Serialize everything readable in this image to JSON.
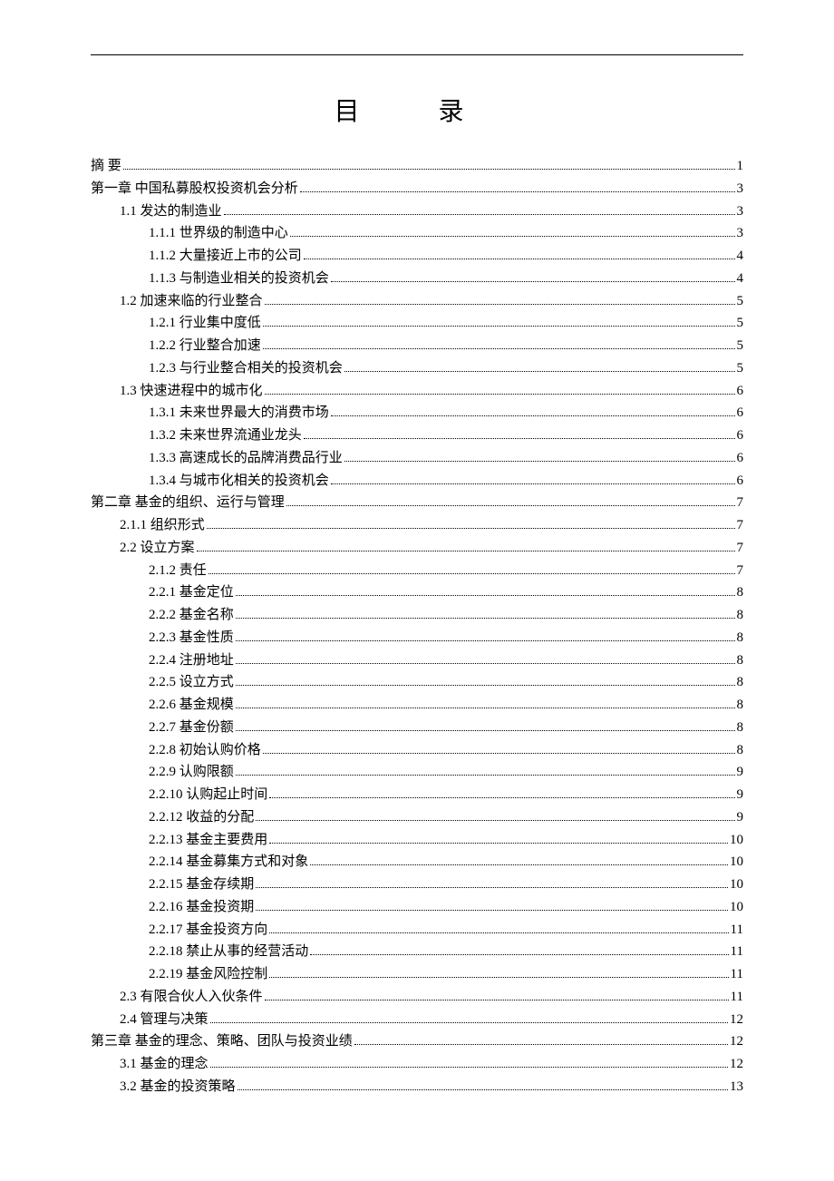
{
  "title": "目  录",
  "toc": [
    {
      "level": 0,
      "label": "摘 要",
      "page": "1"
    },
    {
      "level": 0,
      "label": "第一章 中国私募股权投资机会分析",
      "page": "3"
    },
    {
      "level": 1,
      "label": "1.1 发达的制造业 ",
      "page": "3"
    },
    {
      "level": 2,
      "label": "1.1.1 世界级的制造中心 ",
      "page": "3"
    },
    {
      "level": 2,
      "label": "1.1.2 大量接近上市的公司",
      "page": "4"
    },
    {
      "level": 2,
      "label": "1.1.3 与制造业相关的投资机会",
      "page": "4"
    },
    {
      "level": 1,
      "label": "1.2 加速来临的行业整合 ",
      "page": "5"
    },
    {
      "level": 2,
      "label": "1.2.1 行业集中度低 ",
      "page": "5"
    },
    {
      "level": 2,
      "label": "1.2.2 行业整合加速 ",
      "page": "5"
    },
    {
      "level": 2,
      "label": "1.2.3 与行业整合相关的投资机会 ",
      "page": "5"
    },
    {
      "level": 1,
      "label": "1.3 快速进程中的城市化 ",
      "page": "6"
    },
    {
      "level": 2,
      "label": "1.3.1 未来世界最大的消费市场",
      "page": "6"
    },
    {
      "level": 2,
      "label": "1.3.2 未来世界流通业龙头",
      "page": "6"
    },
    {
      "level": 2,
      "label": "1.3.3 高速成长的品牌消费品行业",
      "page": "6"
    },
    {
      "level": 2,
      "label": "1.3.4 与城市化相关的投资机会 ",
      "page": "6"
    },
    {
      "level": 0,
      "label": "第二章 基金的组织、运行与管理",
      "page": "7"
    },
    {
      "level": 1,
      "label": "2.1.1 组织形式 ",
      "page": "7"
    },
    {
      "level": 1,
      "label": "2.2 设立方案 ",
      "page": "7"
    },
    {
      "level": 2,
      "label": "2.1.2  责任",
      "page": "7"
    },
    {
      "level": 2,
      "label": "2.2.1 基金定位",
      "page": "8"
    },
    {
      "level": 2,
      "label": "2.2.2 基金名称",
      "page": "8"
    },
    {
      "level": 2,
      "label": "2.2.3 基金性质 ",
      "page": "8"
    },
    {
      "level": 2,
      "label": "2.2.4 注册地址",
      "page": "8"
    },
    {
      "level": 2,
      "label": "2.2.5 设立方式",
      "page": "8"
    },
    {
      "level": 2,
      "label": "2.2.6 基金规模 ",
      "page": "8"
    },
    {
      "level": 2,
      "label": "2.2.7 基金份额",
      "page": "8"
    },
    {
      "level": 2,
      "label": "2.2.8 初始认购价格",
      "page": "8"
    },
    {
      "level": 2,
      "label": "2.2.9 认购限额",
      "page": "9"
    },
    {
      "level": 2,
      "label": "2.2.10 认购起止时间 ",
      "page": "9"
    },
    {
      "level": 2,
      "label": "2.2.12 收益的分配",
      "page": "9"
    },
    {
      "level": 2,
      "label": "2.2.13 基金主要费用",
      "page": "10"
    },
    {
      "level": 2,
      "label": "2.2.14 基金募集方式和对象",
      "page": "10"
    },
    {
      "level": 2,
      "label": "2.2.15 基金存续期",
      "page": "10"
    },
    {
      "level": 2,
      "label": "2.2.16 基金投资期",
      "page": "10"
    },
    {
      "level": 2,
      "label": "2.2.17 基金投资方向",
      "page": "11"
    },
    {
      "level": 2,
      "label": "2.2.18 禁止从事的经营活动",
      "page": "11"
    },
    {
      "level": 2,
      "label": "2.2.19 基金风险控制",
      "page": "11"
    },
    {
      "level": 1,
      "label": "2.3 有限合伙人入伙条件 ",
      "page": "11"
    },
    {
      "level": 1,
      "label": "2.4 管理与决策",
      "page": "12"
    },
    {
      "level": 0,
      "label": "第三章 基金的理念、策略、团队与投资业绩",
      "page": "12"
    },
    {
      "level": 1,
      "label": "3.1 基金的理念 ",
      "page": "12"
    },
    {
      "level": 1,
      "label": "3.2 基金的投资策略 ",
      "page": "13"
    }
  ]
}
